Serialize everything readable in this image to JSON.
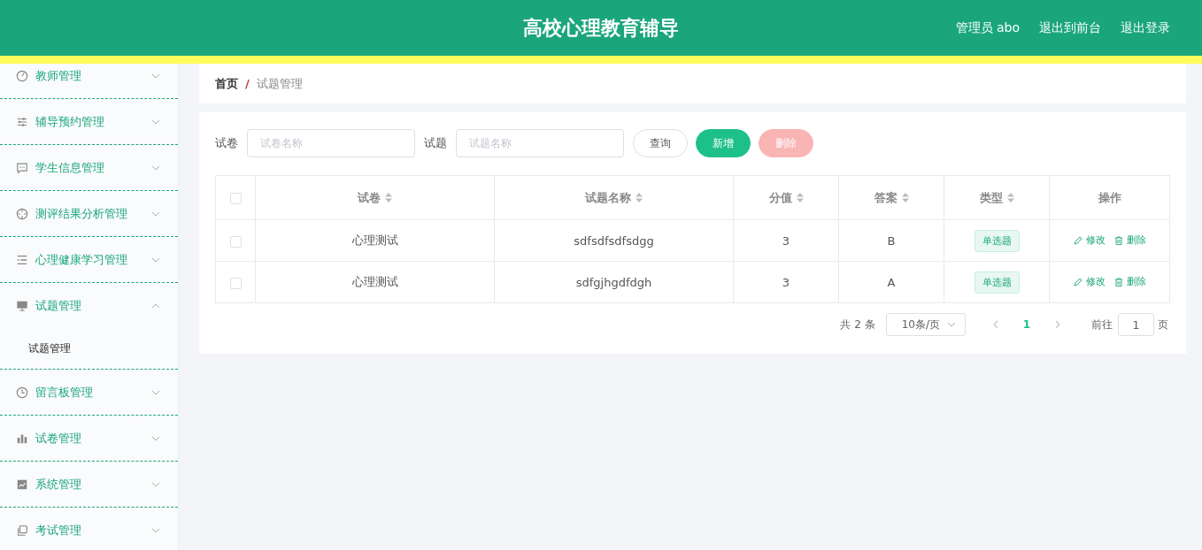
{
  "header": {
    "title": "高校心理教育辅导",
    "user": "管理员 abo",
    "links": [
      "退出到前台",
      "退出登录"
    ]
  },
  "sidebar": {
    "items": [
      {
        "label": "教师管理",
        "kind": "gauge",
        "expanded": false
      },
      {
        "label": "辅导预约管理",
        "kind": "sliders",
        "expanded": false
      },
      {
        "label": "学生信息管理",
        "kind": "chat",
        "expanded": false
      },
      {
        "label": "测评结果分析管理",
        "kind": "crosshair",
        "expanded": false
      },
      {
        "label": "心理健康学习管理",
        "kind": "list",
        "expanded": false
      },
      {
        "label": "试题管理",
        "kind": "monitor",
        "expanded": true,
        "children": [
          {
            "label": "试题管理"
          }
        ]
      },
      {
        "label": "留言板管理",
        "kind": "clock",
        "expanded": false
      },
      {
        "label": "试卷管理",
        "kind": "bars",
        "expanded": false
      },
      {
        "label": "系统管理",
        "kind": "chart",
        "expanded": false
      },
      {
        "label": "考试管理",
        "kind": "copy",
        "expanded": false
      }
    ]
  },
  "breadcrumb": {
    "separator": "/",
    "items": [
      "首页",
      "试题管理"
    ]
  },
  "search": {
    "fields": [
      {
        "label": "试卷",
        "placeholder": "试卷名称"
      },
      {
        "label": "试题",
        "placeholder": "试题名称"
      }
    ],
    "buttons": [
      {
        "label": "查询",
        "kind": "plain",
        "disabled": false
      },
      {
        "label": "新增",
        "kind": "primary",
        "disabled": false
      },
      {
        "label": "删除",
        "kind": "danger",
        "disabled": true
      }
    ]
  },
  "table": {
    "select_all": {
      "checked": false
    },
    "columns": [
      {
        "label": "试卷",
        "sortable": true
      },
      {
        "label": "试题名称",
        "sortable": true
      },
      {
        "label": "分值",
        "sortable": true
      },
      {
        "label": "答案",
        "sortable": true
      },
      {
        "label": "类型",
        "sortable": true
      },
      {
        "label": "操作",
        "sortable": false
      }
    ],
    "rows": [
      {
        "checked": false,
        "cells": [
          "心理测试",
          "sdfsdfsdfsdgg",
          "3",
          "B"
        ],
        "type": "单选题",
        "actions": [
          "修改",
          "删除"
        ]
      },
      {
        "checked": false,
        "cells": [
          "心理测试",
          "sdfgjhgdfdgh",
          "3",
          "A"
        ],
        "type": "单选题",
        "actions": [
          "修改",
          "删除"
        ]
      }
    ]
  },
  "pagination": {
    "total": "共 2 条",
    "page_size": "10条/页",
    "pages": [
      {
        "label": "1",
        "selected": true
      }
    ],
    "goto_label": "前往",
    "goto_value": "1",
    "goto_suffix": "页"
  }
}
